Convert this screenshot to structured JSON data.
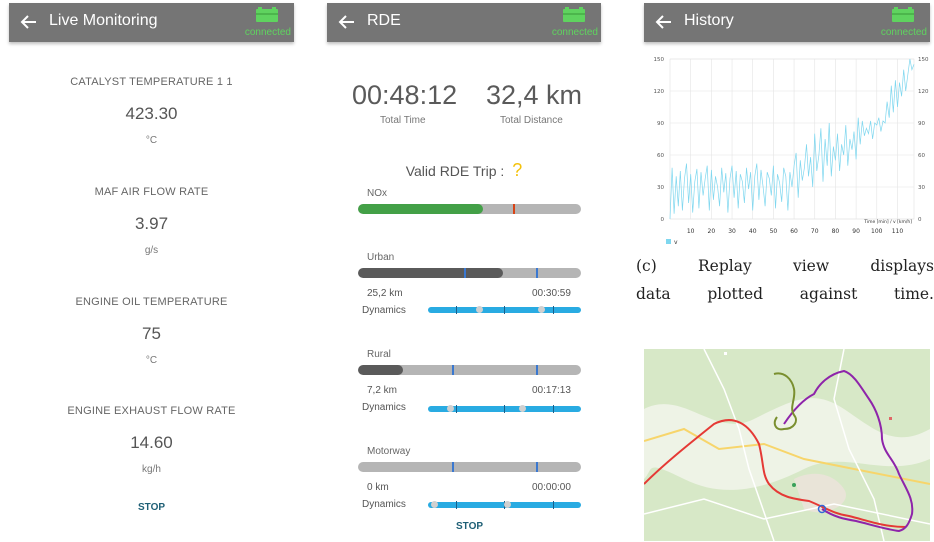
{
  "connection_status": "connected",
  "screen1": {
    "title": "Live Monitoring",
    "params": [
      {
        "name": "CATALYST TEMPERATURE 1 1",
        "value": "423.30",
        "unit": "°C"
      },
      {
        "name": "MAF AIR FLOW RATE",
        "value": "3.97",
        "unit": "g/s"
      },
      {
        "name": "ENGINE OIL TEMPERATURE",
        "value": "75",
        "unit": "°C"
      },
      {
        "name": "ENGINE EXHAUST FLOW RATE",
        "value": "14.60",
        "unit": "kg/h"
      }
    ],
    "stop_label": "STOP"
  },
  "screen2": {
    "title": "RDE",
    "total_time": "00:48:12",
    "total_time_label": "Total Time",
    "total_distance": "32,4 km",
    "total_distance_label": "Total Distance",
    "valid_label": "Valid RDE Trip :",
    "valid_value": "?",
    "nox": {
      "label": "NOx",
      "progress": 0.56
    },
    "urban": {
      "label": "Urban",
      "progress": 0.65,
      "distance": "25,2 km",
      "time": "00:30:59",
      "dynamics_label": "Dynamics",
      "dynamics_dots": [
        0.33,
        0.75
      ]
    },
    "rural": {
      "label": "Rural",
      "progress": 0.2,
      "distance": "7,2 km",
      "time": "00:17:13",
      "dynamics_label": "Dynamics",
      "dynamics_dots": [
        0.13,
        0.62
      ]
    },
    "motorway": {
      "label": "Motorway",
      "progress": 0,
      "distance": "0 km",
      "time": "00:00:00",
      "dynamics_label": "Dynamics",
      "dynamics_dots": [
        0.02,
        0.52
      ]
    },
    "stop_label": "STOP"
  },
  "screen3": {
    "title": "History",
    "caption_line1": "(c) Replay view displays",
    "caption_line2": "data plotted against time."
  },
  "colors": {
    "appbar": "#757575",
    "connected": "#5fd35f",
    "nox_green": "#43a047",
    "urban_fill": "#5a5a5a",
    "dynamics_blue": "#29abe2",
    "tick_blue": "#3a78d0",
    "chart_line": "#7fd7ef",
    "route_red": "#e53935",
    "route_purple": "#8e24aa",
    "route_olive": "#7a8f2f"
  },
  "chart_data": {
    "type": "line",
    "title": "",
    "xlabel": "Time [min] / v [km/h]",
    "ylabel": "",
    "xlim": [
      0,
      118
    ],
    "ylim": [
      0,
      150
    ],
    "x_ticks": [
      10,
      20,
      30,
      40,
      50,
      60,
      70,
      80,
      90,
      100,
      110
    ],
    "y_ticks": [
      0,
      30,
      60,
      90,
      120,
      150
    ],
    "grid": true,
    "legend_position": "bottom-left",
    "series": [
      {
        "name": "v",
        "x": [
          0,
          1,
          2,
          3,
          4,
          5,
          6,
          7,
          8,
          9,
          10,
          11,
          12,
          13,
          14,
          15,
          16,
          17,
          18,
          19,
          20,
          21,
          22,
          23,
          24,
          25,
          26,
          27,
          28,
          29,
          30,
          31,
          32,
          33,
          34,
          35,
          36,
          37,
          38,
          39,
          40,
          41,
          42,
          43,
          44,
          45,
          46,
          47,
          48,
          49,
          50,
          51,
          52,
          53,
          54,
          55,
          56,
          57,
          58,
          59,
          60,
          61,
          62,
          63,
          64,
          65,
          66,
          67,
          68,
          69,
          70,
          71,
          72,
          73,
          74,
          75,
          76,
          77,
          78,
          79,
          80,
          81,
          82,
          83,
          84,
          85,
          86,
          87,
          88,
          89,
          90,
          91,
          92,
          93,
          94,
          95,
          96,
          97,
          98,
          99,
          100,
          101,
          102,
          103,
          104,
          105,
          106,
          107,
          108,
          109,
          110,
          111,
          112,
          113,
          114,
          115,
          116,
          117,
          118
        ],
        "values": [
          0,
          48,
          5,
          40,
          12,
          45,
          8,
          38,
          52,
          15,
          42,
          6,
          35,
          47,
          10,
          44,
          22,
          38,
          50,
          8,
          46,
          18,
          40,
          30,
          12,
          48,
          25,
          43,
          6,
          38,
          50,
          20,
          45,
          10,
          42,
          35,
          15,
          48,
          28,
          44,
          8,
          40,
          52,
          18,
          46,
          30,
          12,
          44,
          38,
          22,
          50,
          10,
          42,
          34,
          16,
          48,
          40,
          8,
          44,
          30,
          50,
          62,
          20,
          55,
          36,
          48,
          70,
          40,
          58,
          30,
          80,
          45,
          60,
          85,
          35,
          75,
          50,
          90,
          40,
          68,
          55,
          80,
          45,
          70,
          60,
          88,
          50,
          75,
          65,
          82,
          56,
          95,
          70,
          92,
          78,
          85,
          80,
          92,
          75,
          90,
          88,
          95,
          82,
          92,
          90,
          110,
          95,
          125,
          100,
          130,
          105,
          128,
          115,
          140,
          120,
          135,
          150,
          140,
          145
        ]
      }
    ]
  }
}
